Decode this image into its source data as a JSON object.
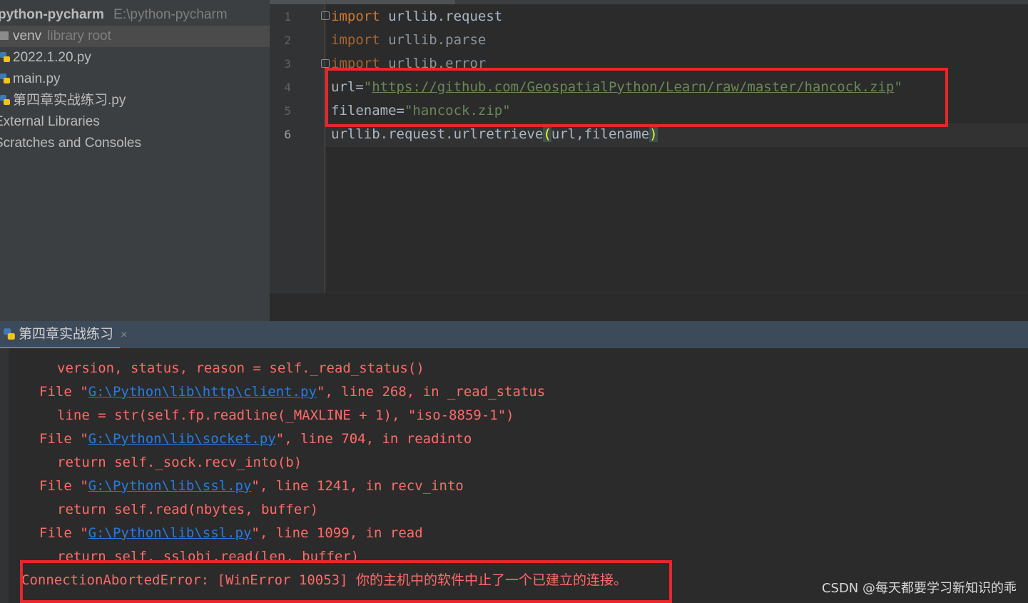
{
  "project_tree": {
    "root_name": "python-pycharm",
    "root_path": "E:\\python-pycharm",
    "items": [
      {
        "label": "venv",
        "sub": "library root"
      },
      {
        "label": "2022.1.20.py"
      },
      {
        "label": "main.py"
      },
      {
        "label": "第四章实战练习.py"
      },
      {
        "label": "External Libraries"
      },
      {
        "label": "Scratches and Consoles"
      }
    ]
  },
  "editor": {
    "line_numbers": [
      "1",
      "2",
      "3",
      "4",
      "5",
      "6"
    ],
    "lines": {
      "l1_kw": "import",
      "l1_rest": " urllib.request",
      "l2_kw": "import",
      "l2_rest": " urllib.parse",
      "l3_kw": "import",
      "l3_rest": " urllib.error",
      "l4_var": "url=",
      "l4_q1": "\"",
      "l4_url": "https://github.com/GeospatialPython/Learn/raw/master/hancock.zip",
      "l4_q2": "\"",
      "l5_var": "filename=",
      "l5_str": "\"hancock.zip\"",
      "l6_call": "urllib.request.urlretrieve",
      "l6_open": "(",
      "l6_args": "url,filename",
      "l6_close": ")"
    }
  },
  "run_panel": {
    "tab_label": "第四章实战练习",
    "close_label": "×",
    "console": [
      {
        "indent": true,
        "text": "version, status, reason = self._read_status()"
      },
      {
        "file_pre": "File \"",
        "link": "G:\\Python\\lib\\http\\client.py",
        "file_post": "\", line 268, in _read_status"
      },
      {
        "indent": true,
        "text": "line = str(self.fp.readline(_MAXLINE + 1), \"iso-8859-1\")"
      },
      {
        "file_pre": "File \"",
        "link": "G:\\Python\\lib\\socket.py",
        "file_post": "\", line 704, in readinto"
      },
      {
        "indent": true,
        "text": "return self._sock.recv_into(b)"
      },
      {
        "file_pre": "File \"",
        "link": "G:\\Python\\lib\\ssl.py",
        "file_post": "\", line 1241, in recv_into"
      },
      {
        "indent": true,
        "text": "return self.read(nbytes, buffer)"
      },
      {
        "file_pre": "File \"",
        "link": "G:\\Python\\lib\\ssl.py",
        "file_post": "\", line 1099, in read"
      },
      {
        "indent": true,
        "text": "return self._sslobj.read(len, buffer)"
      }
    ],
    "error_en": "ConnectionAbortedError: [WinError 10053] ",
    "error_cn": "你的主机中的软件中止了一个已建立的连接。"
  },
  "watermark": "CSDN @每天都要学习新知识的乖",
  "colors": {
    "keyword": "#cc7832",
    "string": "#6a8759",
    "error_text": "#ff6b68",
    "link": "#287bde",
    "highlight_box": "#e8262c"
  }
}
